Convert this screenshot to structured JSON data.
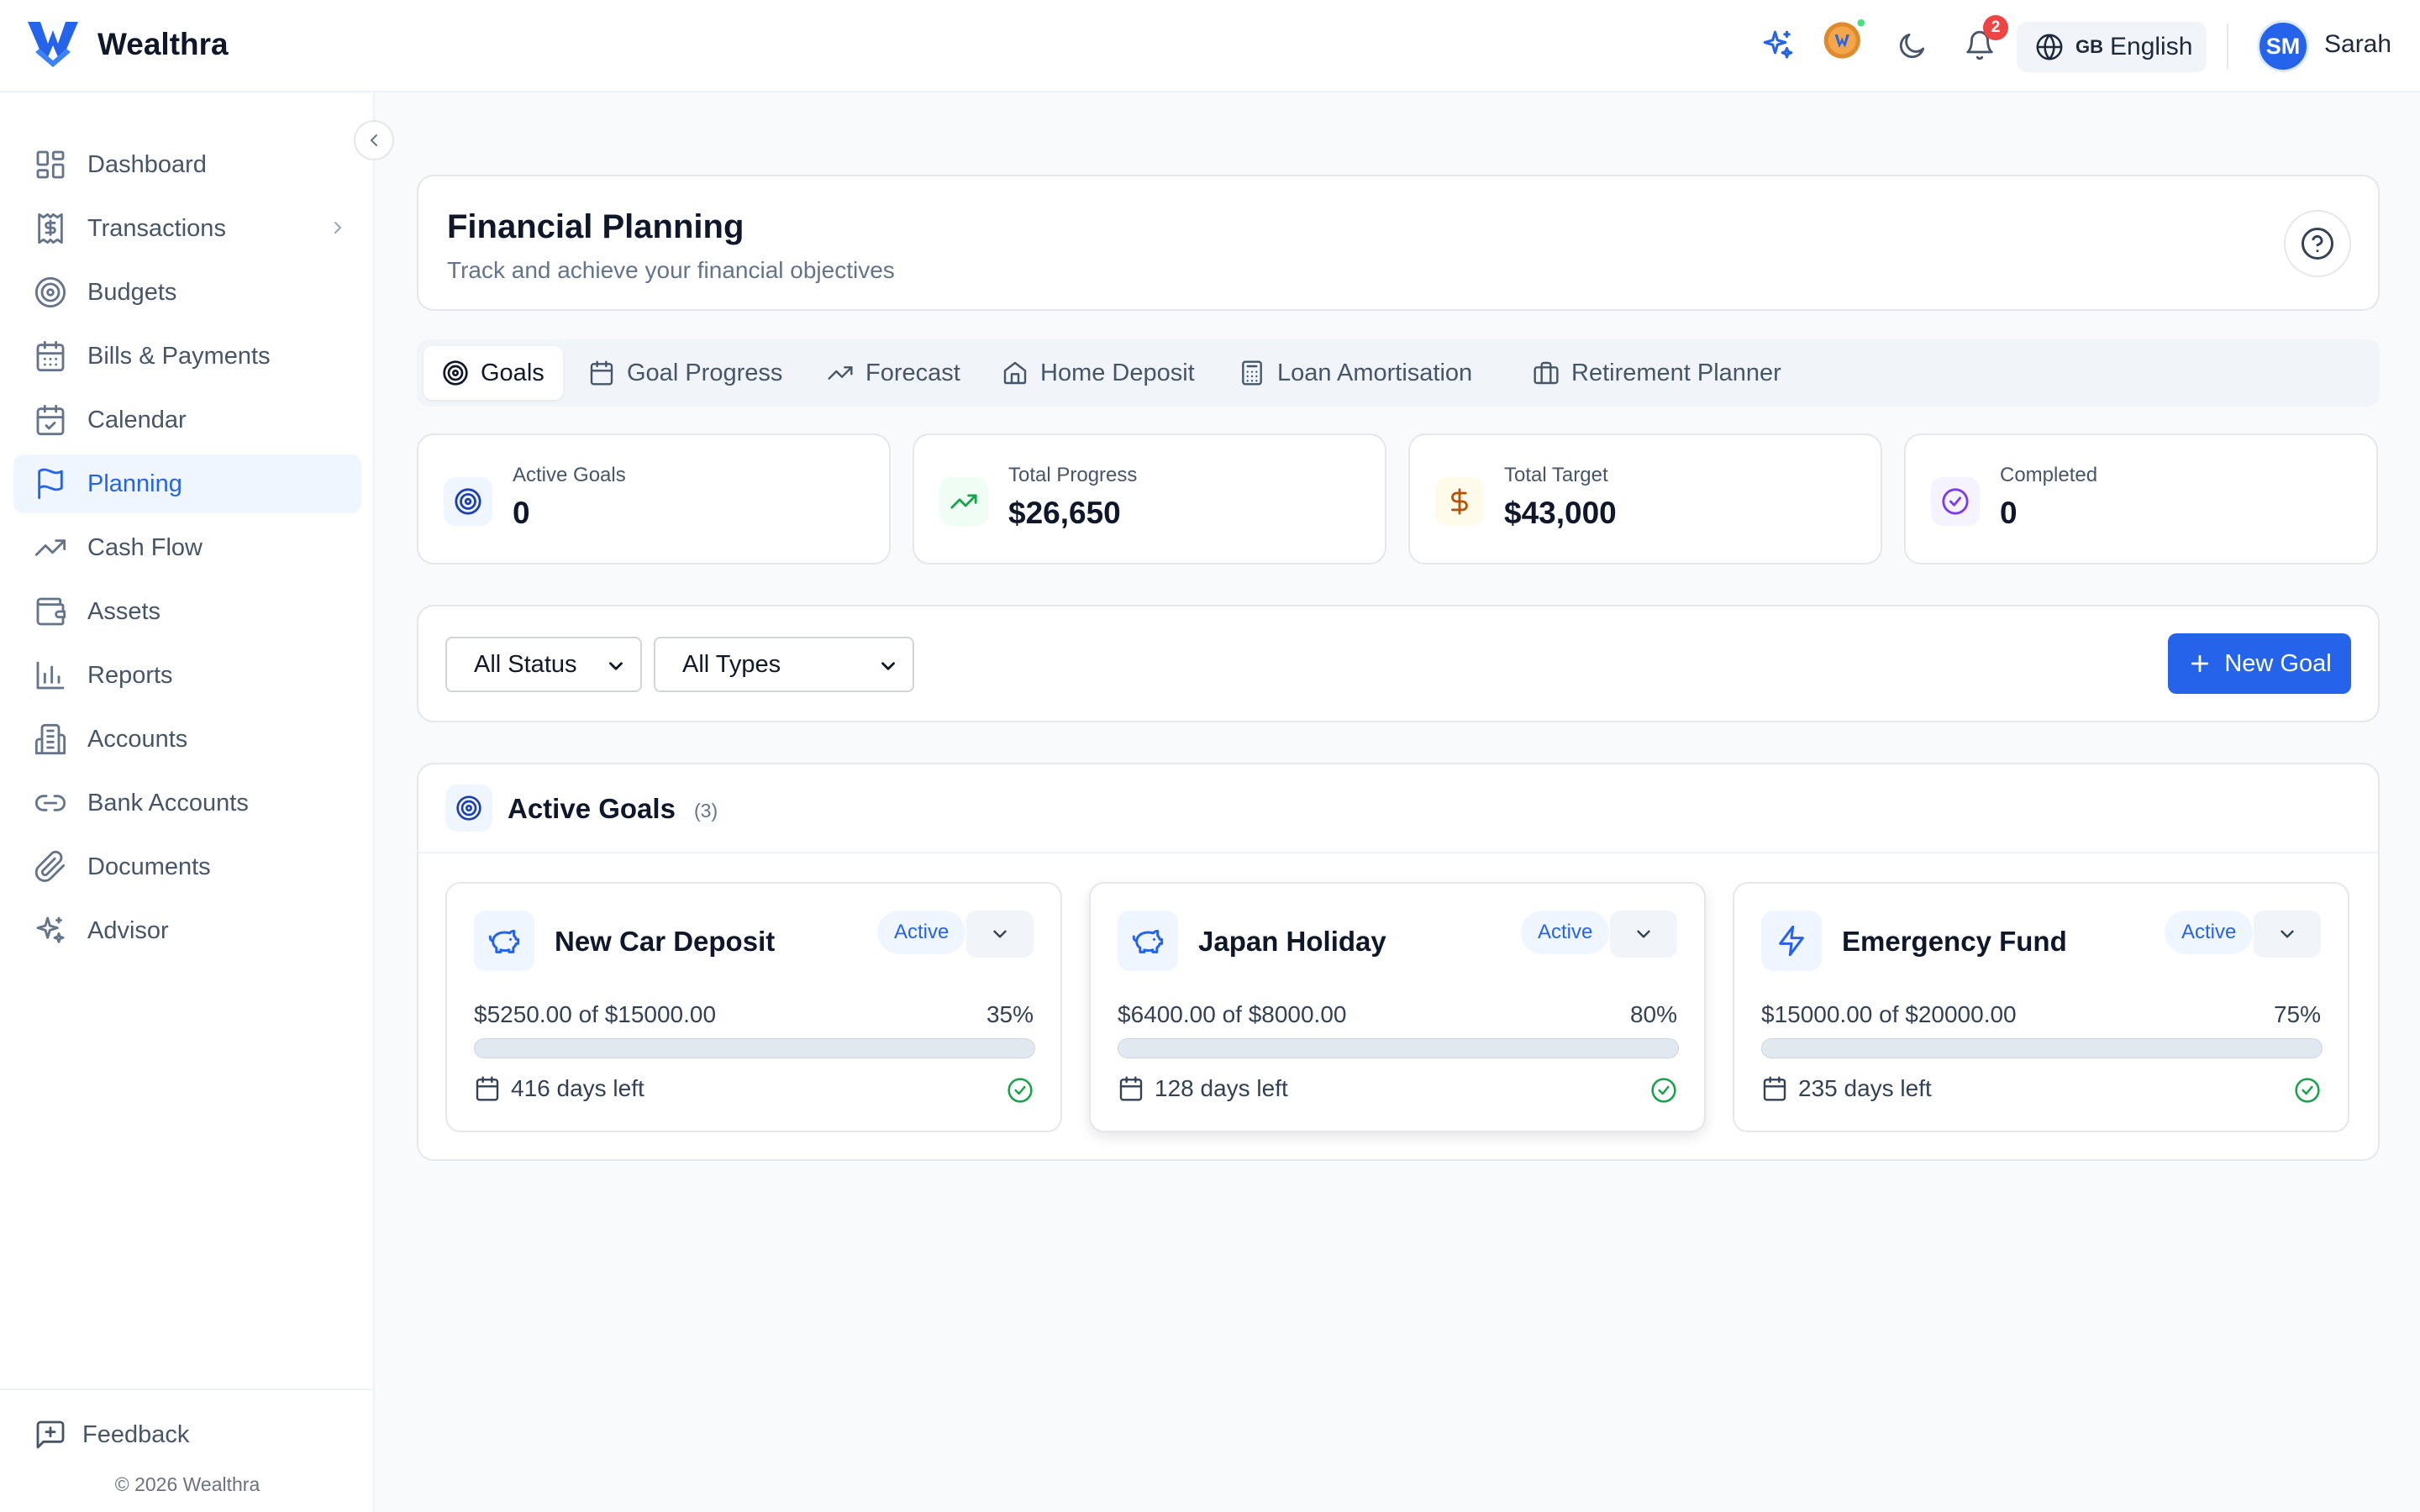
{
  "brand": {
    "name": "Wealthra"
  },
  "header": {
    "notifications_count": "2",
    "language": {
      "flag": "GB",
      "label": "English"
    },
    "user": {
      "initials": "SM",
      "name": "Sarah"
    }
  },
  "sidebar": {
    "items": [
      {
        "label": "Dashboard",
        "icon": "dashboard-icon"
      },
      {
        "label": "Transactions",
        "icon": "receipt-icon",
        "has_children": true
      },
      {
        "label": "Budgets",
        "icon": "target-icon"
      },
      {
        "label": "Bills & Payments",
        "icon": "calendar-icon"
      },
      {
        "label": "Calendar",
        "icon": "calendar-check-icon"
      },
      {
        "label": "Planning",
        "icon": "flag-icon",
        "active": true
      },
      {
        "label": "Cash Flow",
        "icon": "trending-up-icon"
      },
      {
        "label": "Assets",
        "icon": "wallet-icon"
      },
      {
        "label": "Reports",
        "icon": "bar-chart-icon"
      },
      {
        "label": "Accounts",
        "icon": "building-icon"
      },
      {
        "label": "Bank Accounts",
        "icon": "link-icon"
      },
      {
        "label": "Documents",
        "icon": "paperclip-icon"
      },
      {
        "label": "Advisor",
        "icon": "sparkles-icon"
      }
    ],
    "feedback_label": "Feedback",
    "copyright": "© 2026 Wealthra"
  },
  "page": {
    "title": "Financial Planning",
    "subtitle": "Track and achieve your financial objectives"
  },
  "tabs": [
    {
      "label": "Goals",
      "icon": "target-icon",
      "active": true
    },
    {
      "label": "Goal Progress",
      "icon": "calendar-icon"
    },
    {
      "label": "Forecast",
      "icon": "trending-up-icon"
    },
    {
      "label": "Home Deposit",
      "icon": "home-icon"
    },
    {
      "label": "Loan Amortisation",
      "icon": "calculator-icon"
    },
    {
      "label": "Retirement Planner",
      "icon": "briefcase-icon"
    }
  ],
  "stats": [
    {
      "label": "Active Goals",
      "value": "0",
      "icon": "target-icon",
      "color": "#1e40af",
      "bg": "#eff6ff"
    },
    {
      "label": "Total Progress",
      "value": "$26,650",
      "icon": "trending-up-icon",
      "color": "#16a34a",
      "bg": "#f0fdf4"
    },
    {
      "label": "Total Target",
      "value": "$43,000",
      "icon": "dollar-icon",
      "color": "#b45309",
      "bg": "#fffbeb"
    },
    {
      "label": "Completed",
      "value": "0",
      "icon": "check-circle-icon",
      "color": "#7c3aed",
      "bg": "#f5f3ff"
    }
  ],
  "filters": {
    "status": {
      "selected": "All Status"
    },
    "type": {
      "selected": "All Types"
    },
    "new_goal_label": "New Goal"
  },
  "goals_section": {
    "title": "Active Goals",
    "count": "(3)",
    "goals": [
      {
        "name": "New Car Deposit",
        "status": "Active",
        "amount_text": "$5250.00 of $15000.00",
        "percent_text": "35%",
        "progress": 0.35,
        "days_left": "416 days left",
        "icon": "piggy-bank-icon"
      },
      {
        "name": "Japan Holiday",
        "status": "Active",
        "amount_text": "$6400.00 of $8000.00",
        "percent_text": "80%",
        "progress": 0.8,
        "days_left": "128 days left",
        "icon": "piggy-bank-icon"
      },
      {
        "name": "Emergency Fund",
        "status": "Active",
        "amount_text": "$15000.00 of $20000.00",
        "percent_text": "75%",
        "progress": 0.75,
        "days_left": "235 days left",
        "icon": "zap-icon"
      }
    ]
  },
  "colors": {
    "accent": "#2563eb",
    "success": "#16a34a",
    "danger": "#ef4444"
  }
}
